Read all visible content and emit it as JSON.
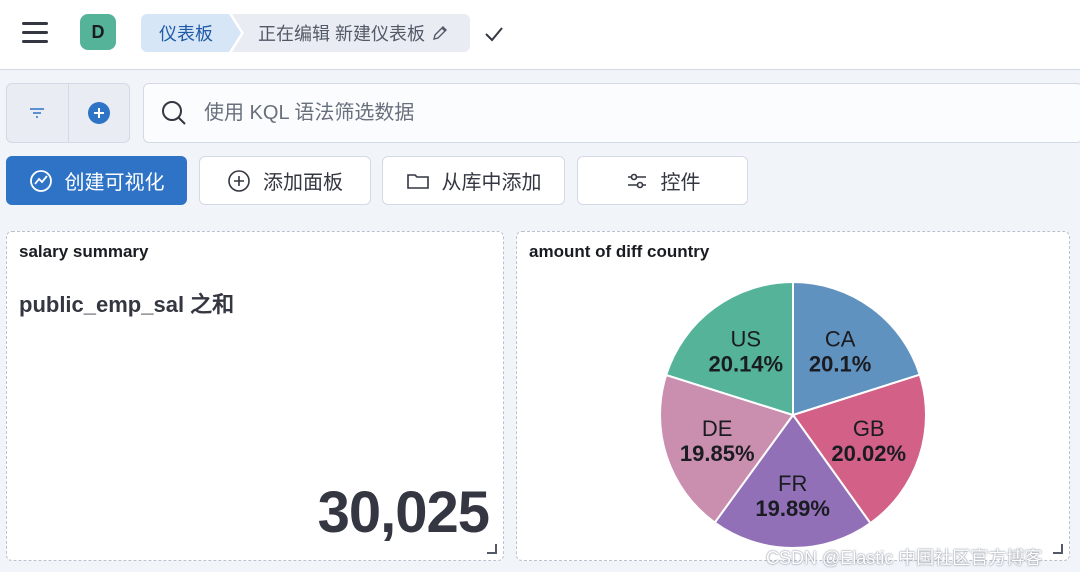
{
  "header": {
    "avatar_letter": "D",
    "breadcrumb_root": "仪表板",
    "breadcrumb_current": "正在编辑 新建仪表板",
    "icons": [
      "menu-icon",
      "pencil-icon",
      "check-icon"
    ]
  },
  "query": {
    "search_placeholder": "使用 KQL 语法筛选数据",
    "icons": [
      "filter-icon",
      "plus-circle-icon",
      "search-icon"
    ]
  },
  "toolbar": {
    "create_visualization": "创建可视化",
    "add_panel": "添加面板",
    "add_from_library": "从库中添加",
    "controls": "控件"
  },
  "panels": {
    "metric": {
      "title": "salary summary",
      "label": "public_emp_sal 之和",
      "value": "30,025"
    },
    "pie": {
      "title": "amount of diff country"
    }
  },
  "chart_data": {
    "type": "pie",
    "title": "amount of diff country",
    "slices": [
      {
        "label": "CA",
        "value": 20.1,
        "display": "20.1%",
        "color": "#6092c0"
      },
      {
        "label": "GB",
        "value": 20.02,
        "display": "20.02%",
        "color": "#d36086"
      },
      {
        "label": "FR",
        "value": 19.89,
        "display": "19.89%",
        "color": "#9170b8"
      },
      {
        "label": "DE",
        "value": 19.85,
        "display": "19.85%",
        "color": "#ca8eae"
      },
      {
        "label": "US",
        "value": 20.14,
        "display": "20.14%",
        "color": "#54b399"
      }
    ],
    "start": "12 o'clock",
    "direction": "clockwise"
  },
  "watermark": "CSDN @Elastic 中国社区官方博客"
}
